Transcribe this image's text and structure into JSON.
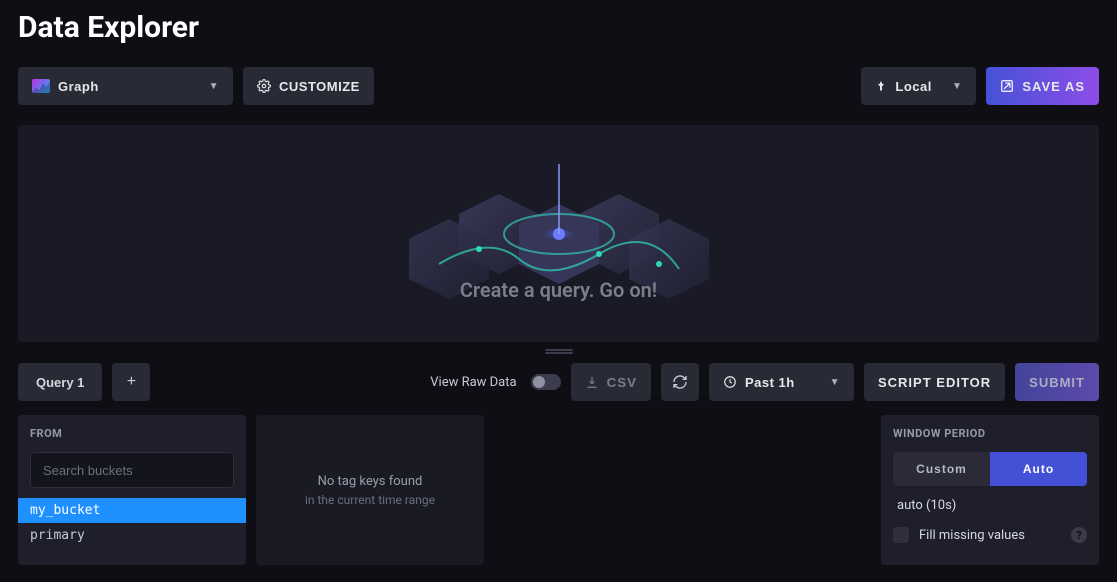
{
  "page": {
    "title": "Data Explorer"
  },
  "toolbar": {
    "viz_type": "Graph",
    "customize": "Customize",
    "local": "Local",
    "save_as": "Save As"
  },
  "canvas": {
    "empty_prompt": "Create a query. Go on!"
  },
  "query_bar": {
    "tab_label": "Query 1",
    "view_raw_label": "View Raw Data",
    "csv_label": "CSV",
    "time_range": "Past 1h",
    "script_editor": "Script Editor",
    "submit": "Submit"
  },
  "from_panel": {
    "title": "From",
    "search_placeholder": "Search buckets",
    "buckets": [
      {
        "name": "my_bucket",
        "selected": true
      },
      {
        "name": "primary",
        "selected": false
      }
    ]
  },
  "tag_panel": {
    "line1": "No tag keys found",
    "line2": "in the current time range"
  },
  "window_panel": {
    "title": "Window Period",
    "custom_label": "Custom",
    "auto_label": "Auto",
    "auto_value": "auto (10s)",
    "fill_label": "Fill missing values"
  }
}
